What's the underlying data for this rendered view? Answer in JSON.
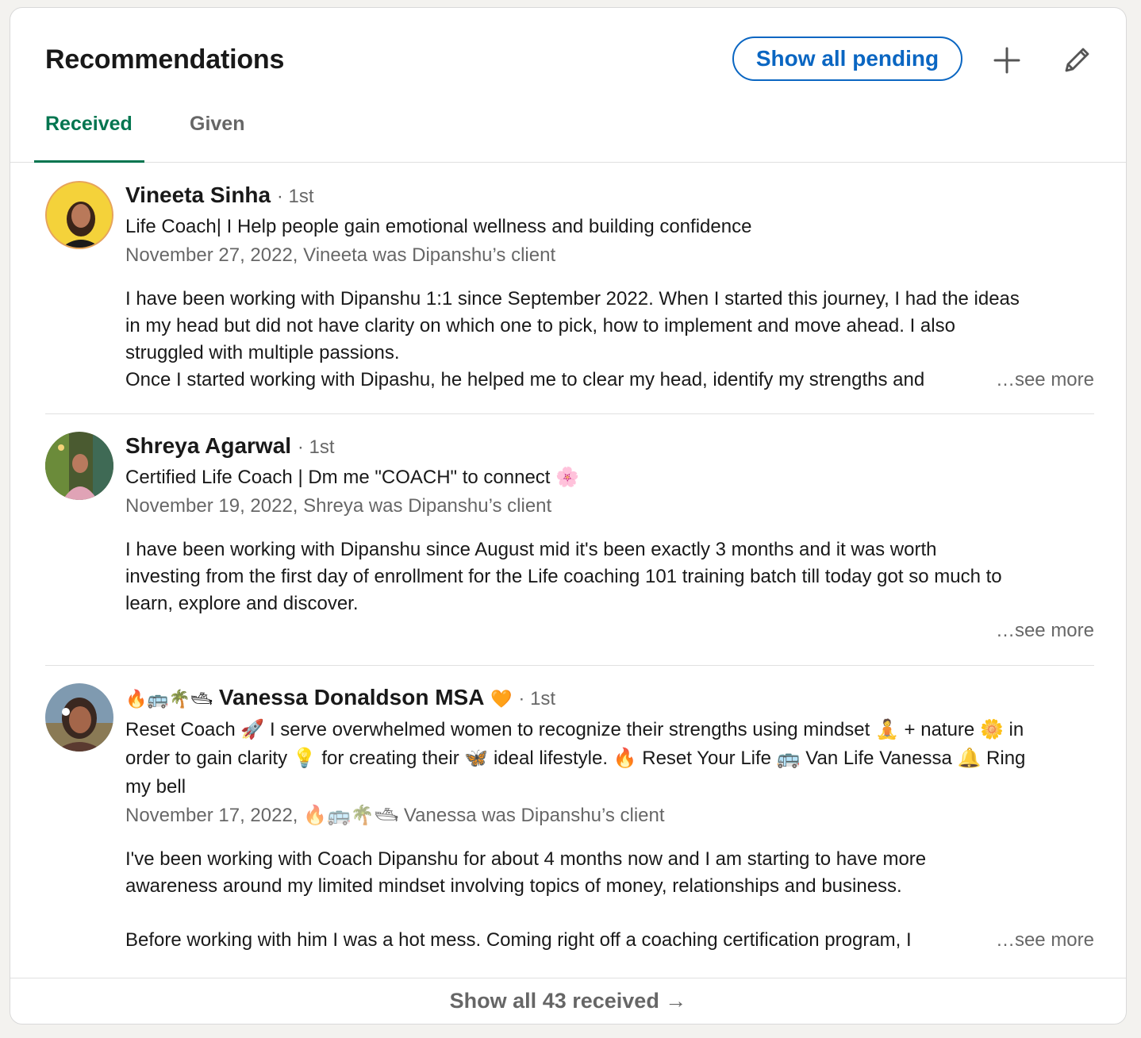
{
  "header": {
    "title": "Recommendations",
    "show_pending_label": "Show all pending",
    "add_icon": "plus-icon",
    "edit_icon": "pencil-icon"
  },
  "tabs": [
    {
      "label": "Received",
      "active": true
    },
    {
      "label": "Given",
      "active": false
    }
  ],
  "recommendations": [
    {
      "name": "Vineeta Sinha",
      "degree": "· 1st",
      "headline": "Life Coach| I Help people gain emotional wellness and building confidence",
      "meta": "November 27, 2022, Vineeta was Dipanshu’s client",
      "body": [
        "I have been working with Dipanshu 1:1 since September 2022. When I started this journey, I had the ideas",
        "in my head but did not have clarity on which one to pick, how to implement and move ahead. I also",
        "struggled with multiple passions.",
        "Once I started working with Dipashu, he helped me to clear my head, identify my strengths and"
      ],
      "see_more": "…see more"
    },
    {
      "name": "Shreya Agarwal",
      "degree": "· 1st",
      "headline": "Certified Life Coach | Dm me \"COACH\" to connect 🌸",
      "meta": "November 19, 2022, Shreya was Dipanshu’s client",
      "body": [
        "I have been working with Dipanshu since August mid it's been exactly 3 months and it was worth",
        "investing from the first day of enrollment for the Life coaching 101 training batch till today got so much to",
        "learn, explore and discover."
      ],
      "see_more": "…see more"
    },
    {
      "name_prefix": "🔥🚌🌴🛥",
      "name": "Vanessa Donaldson MSA",
      "name_suffix": "🧡",
      "degree": "· 1st",
      "headline_lines": [
        "Reset Coach 🚀 I serve overwhelmed women to recognize their strengths using mindset 🧘 + nature 🌼 in",
        "order to gain clarity 💡 for creating their 🦋 ideal lifestyle. 🔥 Reset Your Life 🚌 Van Life Vanessa 🔔 Ring",
        "my bell"
      ],
      "meta": "November 17, 2022, 🔥🚌🌴🛥 Vanessa was Dipanshu’s client",
      "body": [
        "I've been working with Coach Dipanshu for about 4 months now and I am starting to have more",
        "awareness around my limited mindset involving topics of money, relationships and business.",
        "",
        "Before working with him I was a hot mess. Coming right off a coaching certification program, I"
      ],
      "see_more": "…see more"
    }
  ],
  "footer": {
    "label": "Show all 43 received →"
  },
  "colors": {
    "primary_blue": "#0a66c2",
    "active_tab_green": "#01754f"
  }
}
